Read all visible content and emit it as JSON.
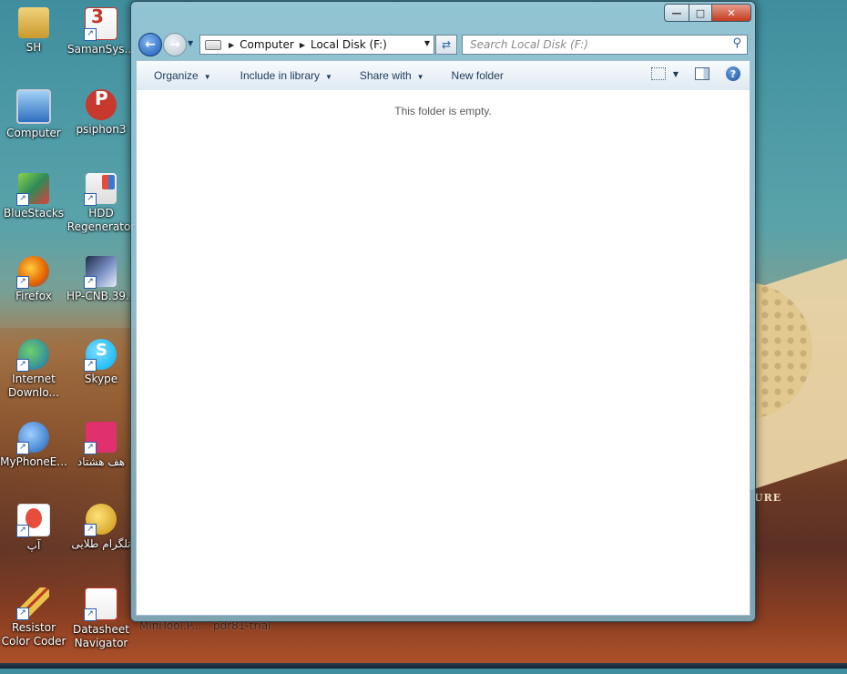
{
  "desktop_icons": [
    {
      "label": "SH",
      "icon": "user-folder-icon",
      "color": "#d9b24a"
    },
    {
      "label": "SamanSys...",
      "icon": "samansys-icon",
      "color": "#c0392b"
    },
    {
      "label": "Computer",
      "icon": "computer-icon",
      "color": "#3a7bd5"
    },
    {
      "label": "psiphon3",
      "icon": "psiphon-icon",
      "color": "#c7392d"
    },
    {
      "label": "BlueStacks",
      "icon": "bluestacks-icon",
      "color": "#4caf50"
    },
    {
      "label": "HDD Regenerator",
      "icon": "hdd-regenerator-icon",
      "color": "#c0392b"
    },
    {
      "label": "Firefox",
      "icon": "firefox-icon",
      "color": "#e66000"
    },
    {
      "label": "HP-CNB.39...",
      "icon": "hp-cnb-icon",
      "color": "#2c3e70"
    },
    {
      "label": "Internet Downlo...",
      "icon": "internet-download-manager-icon",
      "color": "#3aa34a"
    },
    {
      "label": "Skype",
      "icon": "skype-icon",
      "color": "#00aff0"
    },
    {
      "label": "MyPhoneE...",
      "icon": "myphoneexplorer-icon",
      "color": "#2a6fc9"
    },
    {
      "label": "هف هشتاد",
      "icon": "haft-hashtad-icon",
      "color": "#e0306d"
    },
    {
      "label": "آپ",
      "icon": "app-icon",
      "color": "#e74c3c"
    },
    {
      "label": "تلگرام طلایی",
      "icon": "golden-telegram-icon",
      "color": "#d4a017"
    },
    {
      "label": "Resistor Color Coder",
      "icon": "resistor-icon",
      "color": "#d9a400"
    },
    {
      "label": "Datasheet Navigator",
      "icon": "datasheet-navigator-icon",
      "color": "#c0392b"
    }
  ],
  "background_items": [
    "MiniTool.P...",
    "pdr81-trial",
    "URE"
  ],
  "window": {
    "address_crumbs": [
      "Computer",
      "Local Disk (F:)"
    ],
    "search_placeholder": "Search Local Disk (F:)",
    "toolbar": {
      "organize": "Organize",
      "include_in_library": "Include in library",
      "share_with": "Share with",
      "new_folder": "New folder"
    },
    "empty_message": "This folder is empty."
  }
}
